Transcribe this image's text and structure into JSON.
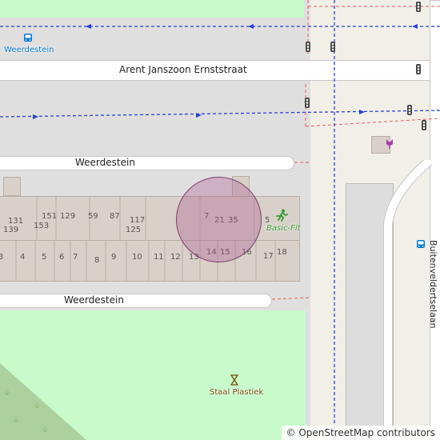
{
  "streets": {
    "top": "Arent Janszoon Ernststraat",
    "middle": "Weerdestein",
    "bottom": "Weerdestein",
    "right_vertical": "Buitenveldertselaan"
  },
  "pois": {
    "bus_stop": "Weerdestein",
    "gym": "Basic-Fit",
    "works": "Staal Plastiek"
  },
  "house_numbers": {
    "upper": [
      "131",
      "139",
      "151",
      "153",
      "129",
      "59",
      "87",
      "117",
      "125",
      "7",
      "21",
      "35",
      "5"
    ],
    "lower": [
      "3",
      "4",
      "5",
      "6",
      "7",
      "8",
      "9",
      "10",
      "11",
      "12",
      "13",
      "14",
      "15",
      "16",
      "17",
      "18"
    ]
  },
  "attribution": "© OpenStreetMap contributors",
  "colors": {
    "park": "#c8facc",
    "building": "#d9d0c9",
    "transit_line": "#2a3fd6",
    "boundary_line": "#ea5b5b",
    "marker_fill": "#a85a8c",
    "gym_icon": "#2e9a2e",
    "bus_icon": "#0078d4"
  },
  "icons": [
    "bus-stop-icon",
    "fitness-icon",
    "hardware-shop-icon",
    "traffic-signal-icon",
    "bus-station-icon"
  ]
}
